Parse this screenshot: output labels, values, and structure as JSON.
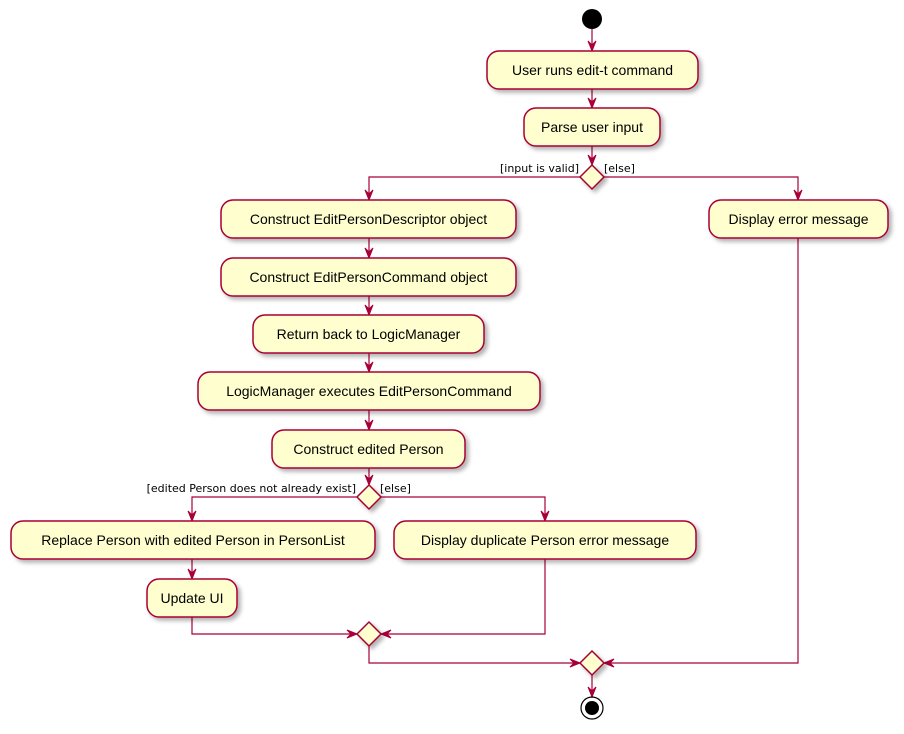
{
  "colors": {
    "fill": "#FEFECE",
    "stroke": "#A80036",
    "start": "#000000"
  },
  "activities": {
    "user_runs": "User runs edit-t command",
    "parse": "Parse user input",
    "construct_descriptor": "Construct EditPersonDescriptor object",
    "construct_command": "Construct EditPersonCommand object",
    "return_logic": "Return back to LogicManager",
    "logic_executes": "LogicManager executes EditPersonCommand",
    "construct_edited": "Construct edited Person",
    "replace_person": "Replace Person with edited Person in PersonList",
    "update_ui": "Update UI",
    "display_duplicate": "Display duplicate Person error message",
    "display_error": "Display error message"
  },
  "guards": {
    "input_valid": "[input is valid]",
    "input_else": "[else]",
    "not_exist": "[edited Person does not already exist]",
    "exist_else": "[else]"
  }
}
